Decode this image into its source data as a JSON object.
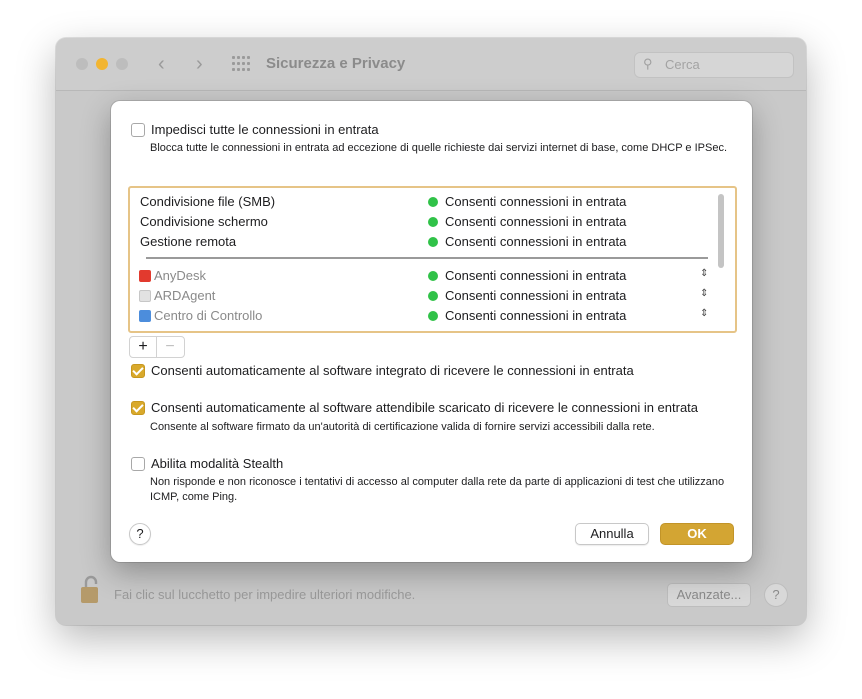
{
  "window": {
    "title": "Sicurezza e Privacy",
    "search_placeholder": "Cerca",
    "lock_text": "Fai clic sul lucchetto per impedire ulteriori modifiche.",
    "advanced_button": "Avanzate...",
    "help_button": "?"
  },
  "sheet": {
    "block_all": {
      "checked": false,
      "label": "Impedisci tutte le connessioni in entrata",
      "description": "Blocca tutte le connessioni in entrata ad eccezione di quelle richieste dai servizi internet di base, come DHCP e IPSec."
    },
    "services": [
      {
        "name": "Condivisione file (SMB)",
        "status": "Consenti connessioni in entrata"
      },
      {
        "name": "Condivisione schermo",
        "status": "Consenti connessioni in entrata"
      },
      {
        "name": "Gestione remota",
        "status": "Consenti connessioni in entrata"
      }
    ],
    "apps": [
      {
        "name": "AnyDesk",
        "icon": "anydesk-icon",
        "status": "Consenti connessioni in entrata"
      },
      {
        "name": "ARDAgent",
        "icon": "ardagent-icon",
        "status": "Consenti connessioni in entrata"
      },
      {
        "name": "Centro di Controllo",
        "icon": "control-center-icon",
        "status": "Consenti connessioni in entrata"
      }
    ],
    "add_button": "+",
    "remove_button": "−",
    "auto_builtin": {
      "checked": true,
      "label": "Consenti automaticamente al software integrato di ricevere le connessioni in entrata"
    },
    "auto_signed": {
      "checked": true,
      "label": "Consenti automaticamente al software attendibile scaricato di ricevere le connessioni in entrata",
      "description": "Consente al software firmato da un'autorità di certificazione valida di fornire servizi accessibili dalla rete."
    },
    "stealth": {
      "checked": false,
      "label": "Abilita modalità Stealth",
      "description": "Non risponde e non riconosce i tentativi di accesso al computer dalla rete da parte di applicazioni di test che utilizzano ICMP, come Ping."
    },
    "help_button": "?",
    "cancel_button": "Annulla",
    "ok_button": "OK"
  },
  "colors": {
    "accent": "#d9a92b",
    "status_green": "#30c248",
    "list_focus_border": "#e6c487"
  }
}
